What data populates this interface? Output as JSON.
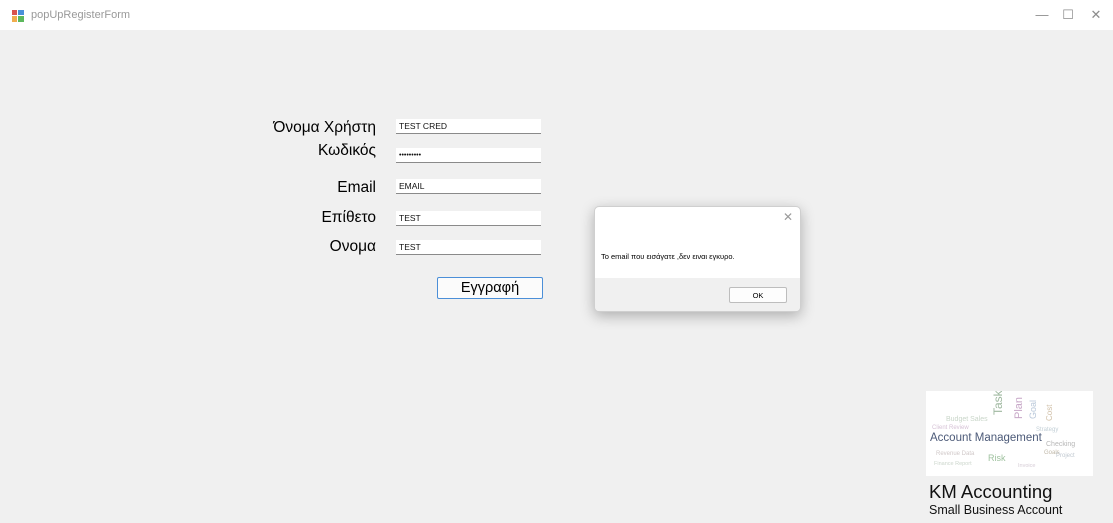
{
  "window": {
    "title": "popUpRegisterForm",
    "controls": {
      "minimize": "—",
      "maximize": "☐",
      "close": "✕"
    }
  },
  "form": {
    "username": {
      "label": "Όνομα Χρήστη",
      "value": "TEST CRED"
    },
    "password": {
      "label": "Κωδικός",
      "value": "TESTCRED1"
    },
    "email": {
      "label": "Email",
      "value": "EMAIL"
    },
    "surname": {
      "label": "Επίθετο",
      "value": "TEST"
    },
    "firstname": {
      "label": "Ονομα",
      "value": "TEST"
    },
    "register_label": "Εγγραφή"
  },
  "dialog": {
    "message": "Το email που εισάγατε ,δεν ειναι εγκυρο.",
    "ok_label": "OK",
    "close": "✕"
  },
  "brand": {
    "logo_text": "Account Management",
    "name": "KM Accounting",
    "tagline": "Small Business Account"
  },
  "colors": {
    "window_bg": "#f0f0f0",
    "titlebar_bg": "#ffffff",
    "button_focus_border": "#4b8fd8",
    "dialog_footer_bg": "#f0f0f0"
  }
}
